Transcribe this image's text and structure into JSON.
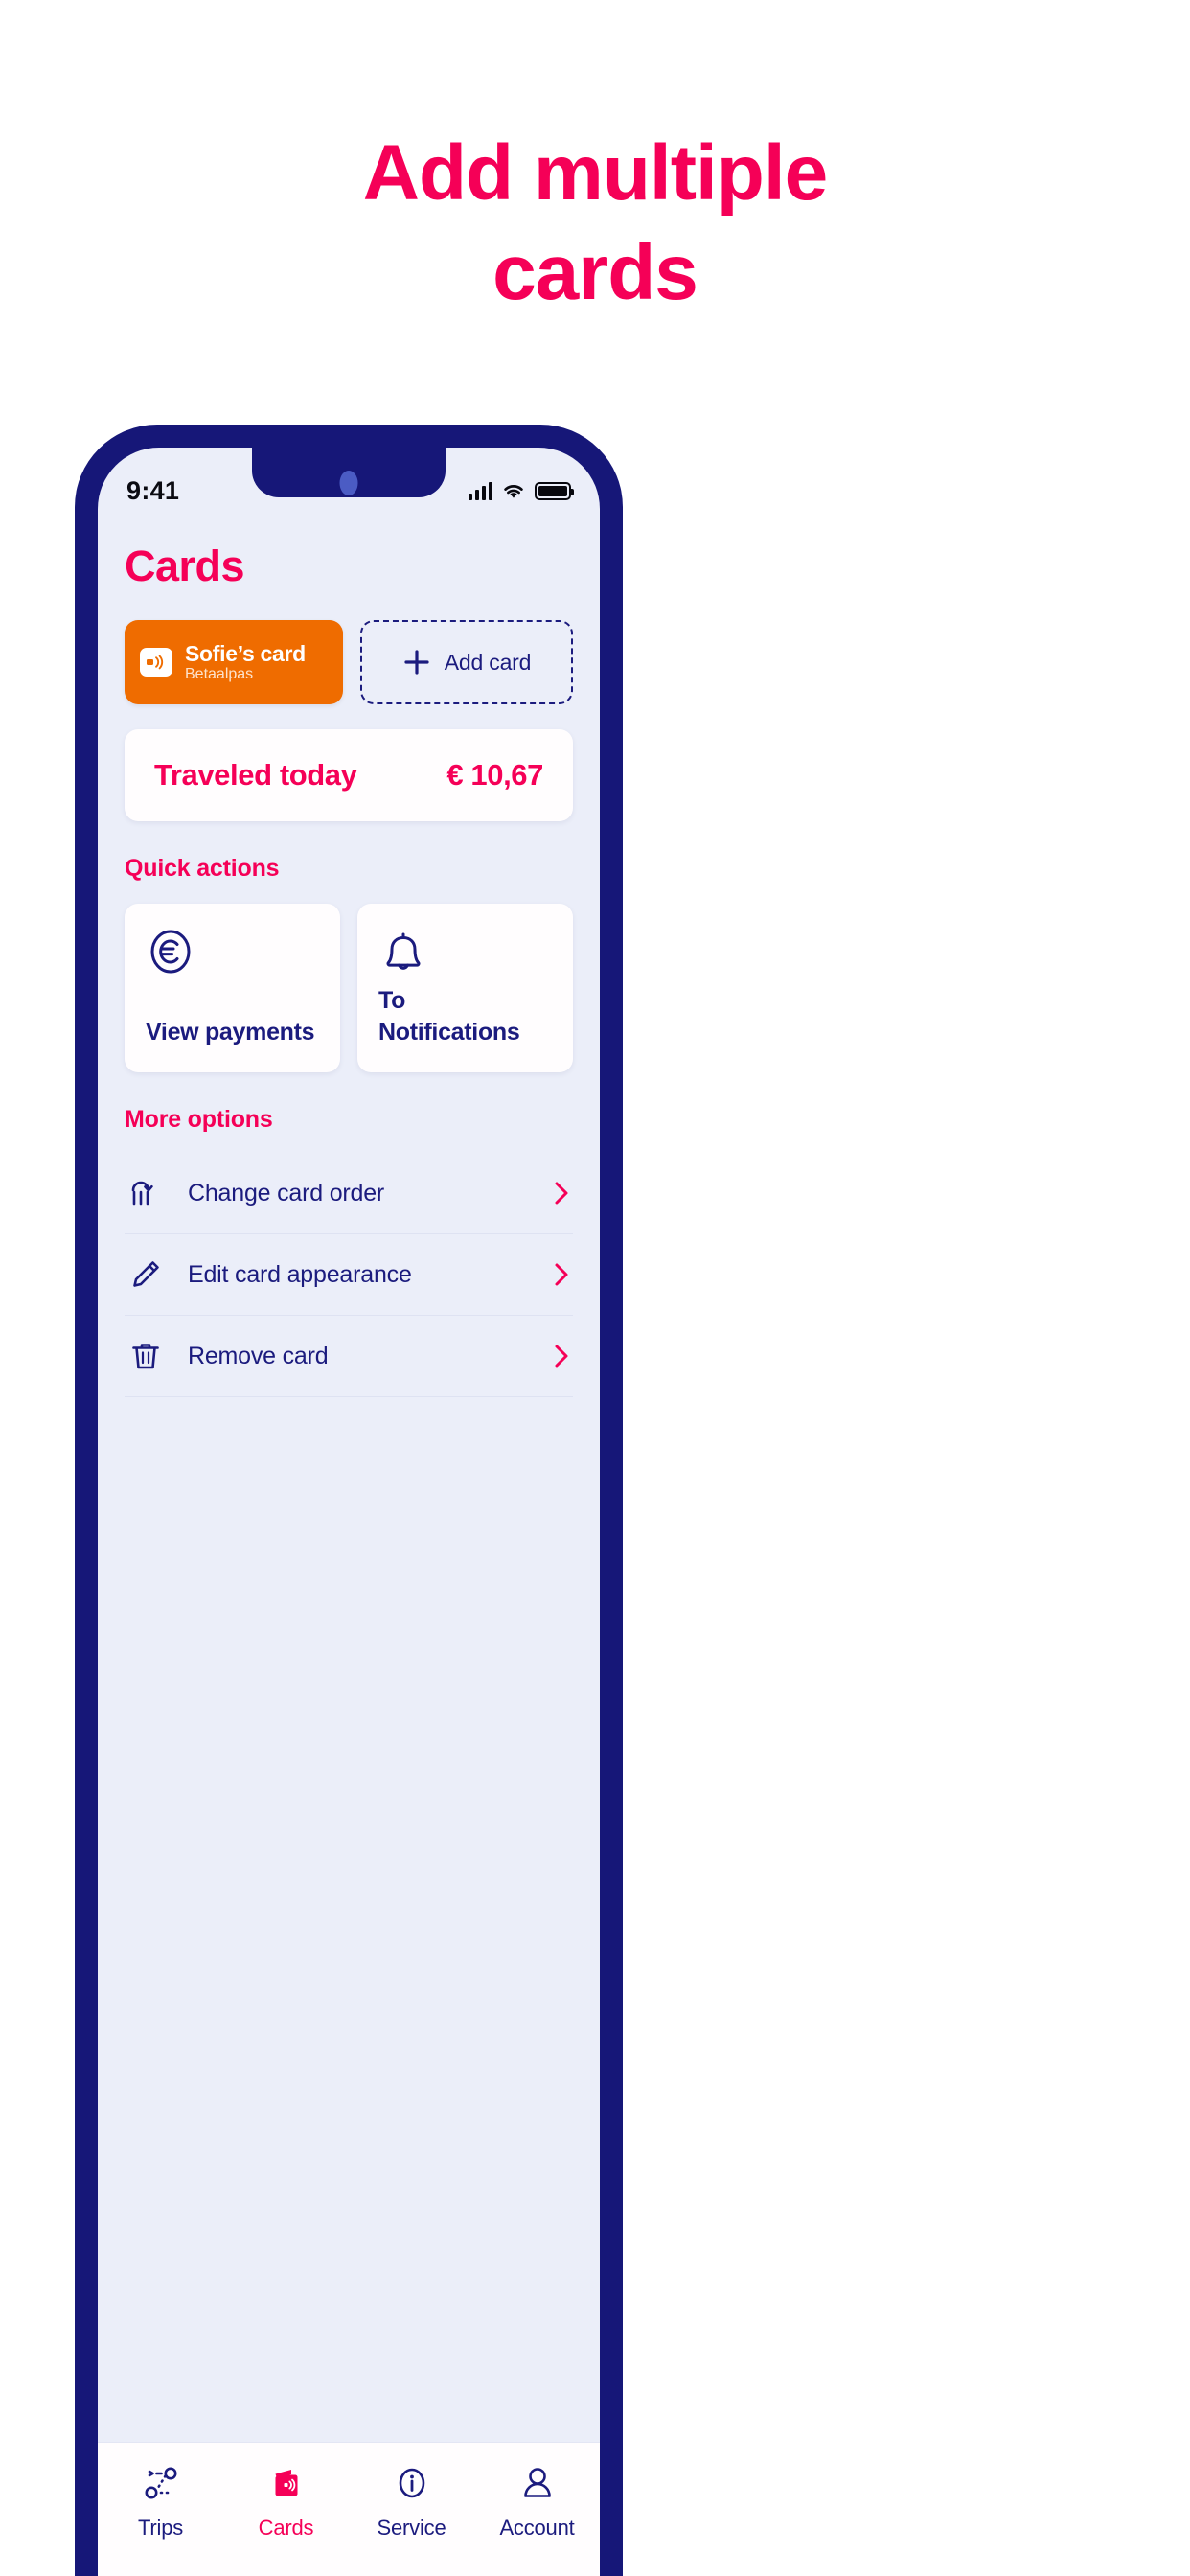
{
  "promo": {
    "line1": "Add multiple",
    "line2": "cards"
  },
  "colors": {
    "pink": "#f50057",
    "navy": "#1b1b7e",
    "frame": "#161778",
    "orange": "#ef6c00",
    "screen_bg": "#ebeef9",
    "card_bg": "#fffdfe"
  },
  "status_bar": {
    "time": "9:41",
    "signal_icon": "signal-bars-icon",
    "wifi_icon": "wifi-icon",
    "battery_icon": "battery-full-icon"
  },
  "screen": {
    "page_title": "Cards",
    "my_card": {
      "icon": "contactless-card-icon",
      "name": "Sofie’s card",
      "subtitle": "Betaalpas"
    },
    "add_card": {
      "icon": "plus-icon",
      "label": "Add card"
    },
    "traveled": {
      "label": "Traveled today",
      "amount": "€ 10,67"
    },
    "quick_actions": {
      "heading": "Quick actions",
      "tiles": [
        {
          "icon": "euro-circle-icon",
          "label": "View payments"
        },
        {
          "icon": "bell-icon",
          "label": "To Notifications"
        }
      ]
    },
    "more_options": {
      "heading": "More options",
      "items": [
        {
          "icon": "reorder-cards-icon",
          "label": "Change card order",
          "chevron": "chevron-right-icon"
        },
        {
          "icon": "pencil-icon",
          "label": "Edit card appearance",
          "chevron": "chevron-right-icon"
        },
        {
          "icon": "trash-icon",
          "label": "Remove card",
          "chevron": "chevron-right-icon"
        }
      ]
    },
    "tabs": [
      {
        "icon": "route-icon",
        "label": "Trips",
        "active": false
      },
      {
        "icon": "cards-icon",
        "label": "Cards",
        "active": true
      },
      {
        "icon": "info-icon",
        "label": "Service",
        "active": false
      },
      {
        "icon": "account-icon",
        "label": "Account",
        "active": false
      }
    ]
  }
}
